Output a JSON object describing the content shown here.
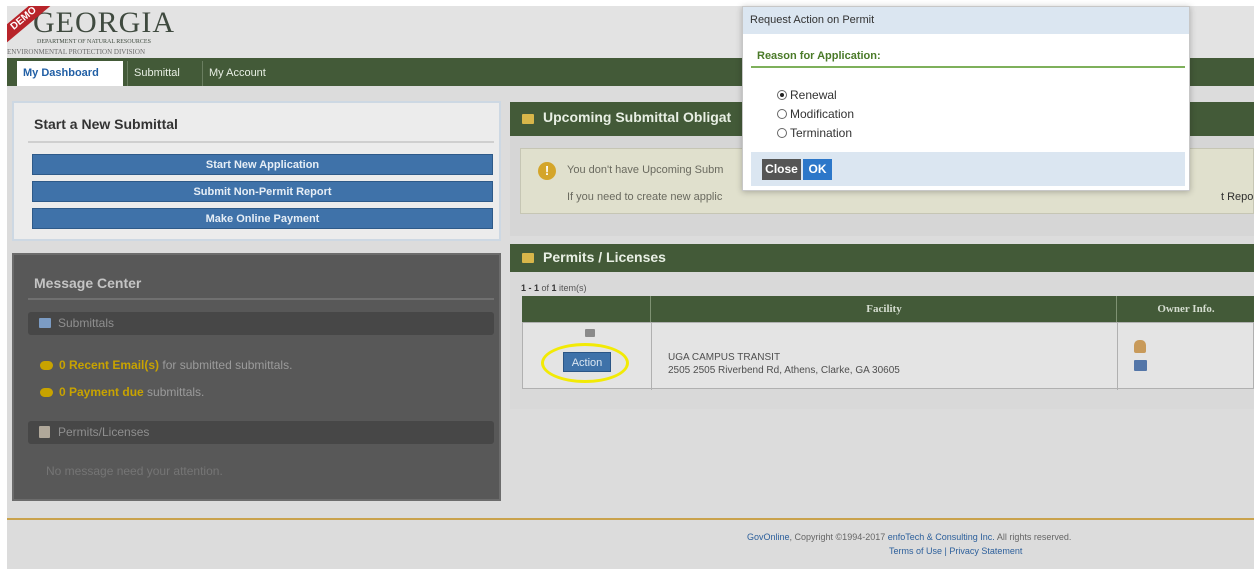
{
  "brand": {
    "ribbon": "DEMO",
    "logo_main": "GEORGIA",
    "logo_sub1": "DEPARTMENT OF NATURAL RESOURCES",
    "logo_sub2": "ENVIRONMENTAL PROTECTION DIVISION"
  },
  "nav": {
    "tabs": [
      {
        "label": "My Dashboard",
        "active": true
      },
      {
        "label": "Submittal",
        "active": false
      },
      {
        "label": "My Account",
        "active": false
      }
    ]
  },
  "new_submittal": {
    "title": "Start a New Submittal",
    "buttons": [
      "Start New Application",
      "Submit Non-Permit Report",
      "Make Online Payment"
    ]
  },
  "message_center": {
    "title": "Message Center",
    "submittals_label": "Submittals",
    "email_count": "0 Recent Email(s)",
    "email_suffix": " for submitted submittals.",
    "payment_count": "0 Payment due",
    "payment_suffix": " submittals.",
    "permits_label": "Permits/Licenses",
    "no_message": "No message need your attention."
  },
  "obligations": {
    "title": "Upcoming Submittal Obligat",
    "line1": "You don't have Upcoming Subm",
    "line2": "If you need to create new applic",
    "line3_tail": "t Report, o"
  },
  "permits": {
    "title": "Permits / Licenses",
    "count_prefix": "1 - 1",
    "count_mid": " of ",
    "count_total": "1",
    "count_suffix": " item(s)",
    "columns": [
      "Facility",
      "Owner Info."
    ],
    "rows": [
      {
        "action_label": "Action",
        "facility_name": "UGA CAMPUS TRANSIT",
        "facility_address": "2505 2505 Riverbend Rd, Athens, Clarke, GA 30605"
      }
    ]
  },
  "footer": {
    "product": "GovOnline",
    "copyright": ", Copyright ©1994-2017 ",
    "company": "enfoTech & Consulting Inc.",
    "rights": " All rights reserved.",
    "terms": "Terms of Use",
    "separator": " | ",
    "privacy": "Privacy Statement"
  },
  "dialog": {
    "title": "Request Action on Permit",
    "reason_label": "Reason for Application:",
    "options": [
      {
        "label": "Renewal",
        "selected": true
      },
      {
        "label": "Modification",
        "selected": false
      },
      {
        "label": "Termination",
        "selected": false
      }
    ],
    "close_label": "Close",
    "ok_label": "OK"
  },
  "colors": {
    "nav_green": "#435a38",
    "button_blue": "#3f72a9",
    "dialog_accent": "#7eb05b",
    "highlight_yellow": "#f2ea05"
  }
}
